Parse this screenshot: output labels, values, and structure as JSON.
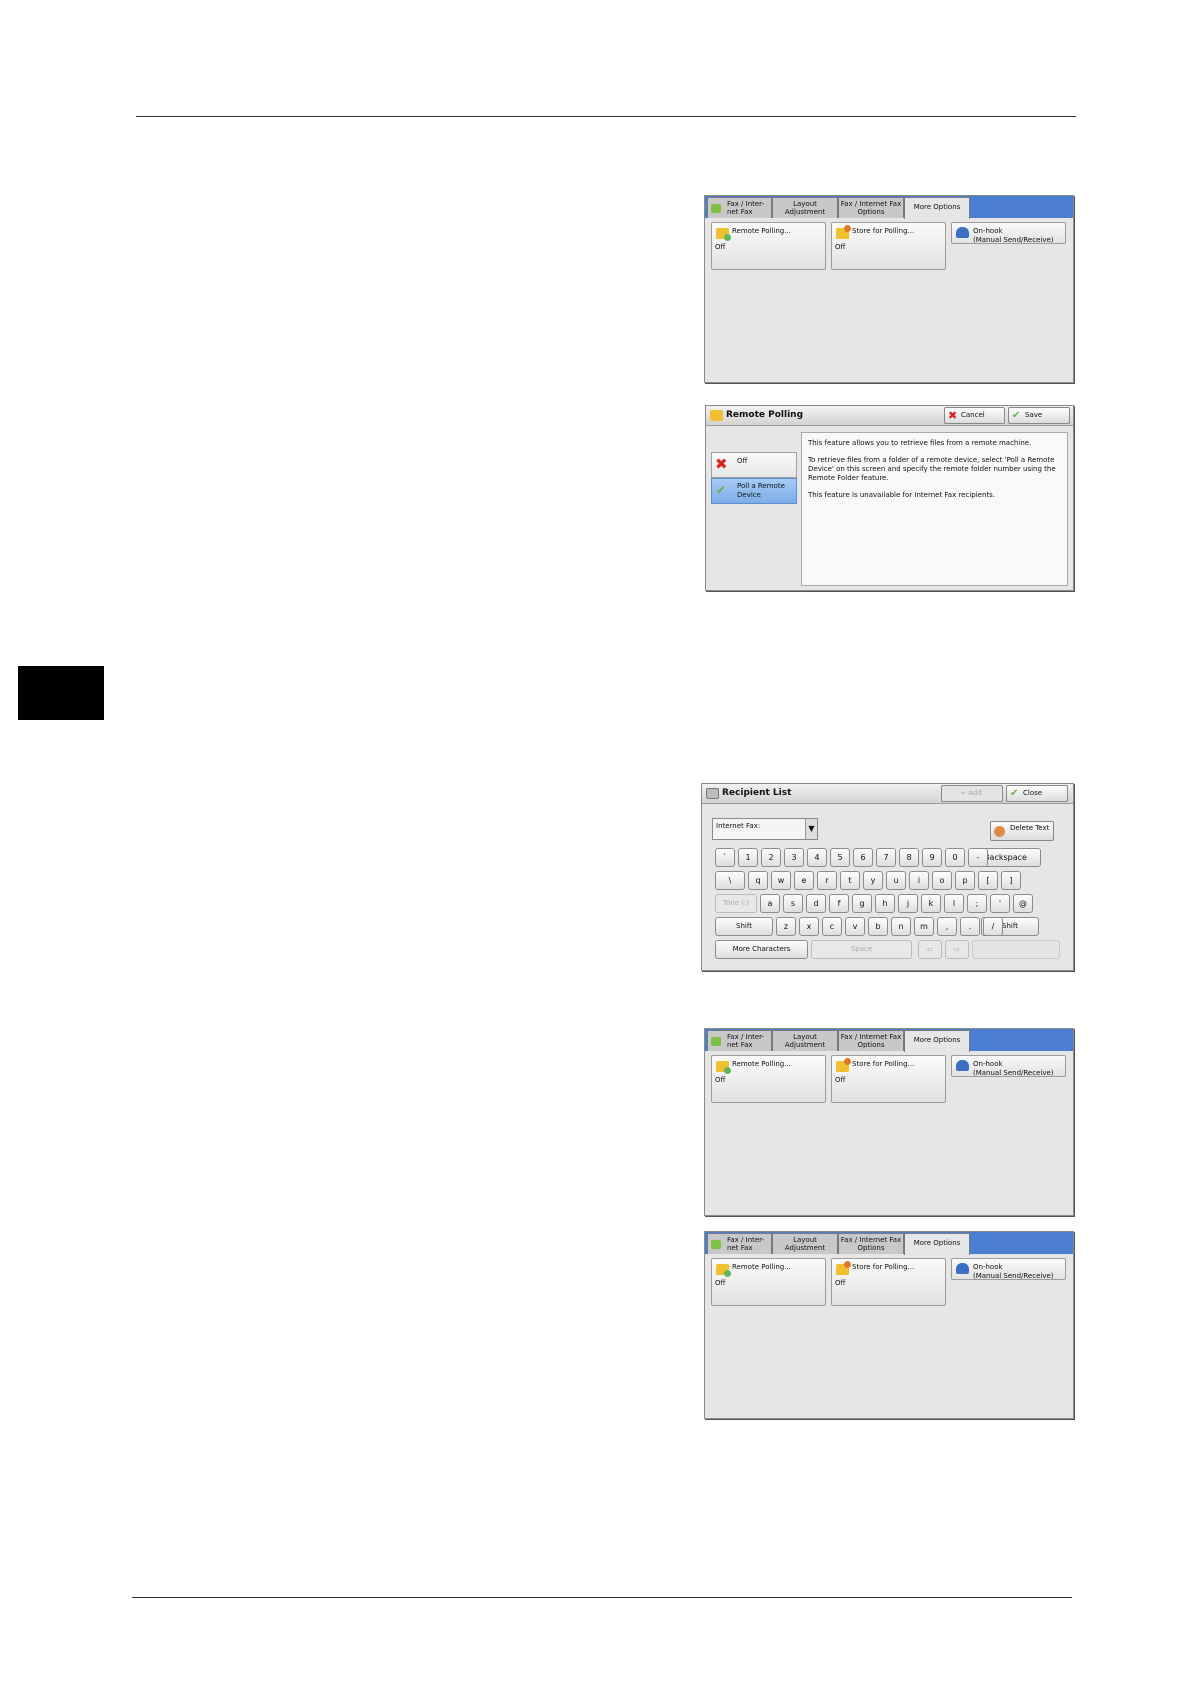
{
  "tabs": [
    "Fax / Inter- net Fax",
    "Layout Adjustment",
    "Fax / Internet Fax Options",
    "More Options"
  ],
  "more_options": {
    "remote_polling_label": "Remote Polling...",
    "remote_polling_value": "Off",
    "store_polling_label": "Store for Polling...",
    "store_polling_value": "Off",
    "onhook_line1": "On-hook",
    "onhook_line2": "(Manual Send/Receive)"
  },
  "remote_polling_dialog": {
    "title": "Remote Polling",
    "cancel": "Cancel",
    "save": "Save",
    "options": [
      "Off",
      "Poll a Remote Device"
    ],
    "info": [
      "This feature allows you to retrieve files from a remote machine.",
      "To retrieve files from a folder of a remote device, select 'Poll a Remote Device' on this screen and specify the remote folder number using the Remote Folder feature.",
      "This feature is unavailable for Internet Fax recipients."
    ]
  },
  "recipient_list": {
    "title": "Recipient List",
    "add": "+ Add",
    "close": "Close",
    "combo_label": "Internet Fax:",
    "delete_text": "Delete Text",
    "row1": [
      "`",
      "1",
      "2",
      "3",
      "4",
      "5",
      "6",
      "7",
      "8",
      "9",
      "0",
      "-"
    ],
    "backspace": "Backspace",
    "row2": [
      "\\",
      "q",
      "w",
      "e",
      "r",
      "t",
      "y",
      "u",
      "i",
      "o",
      "p",
      "[",
      "]"
    ],
    "tone": "Tone (:)",
    "row3": [
      "a",
      "s",
      "d",
      "f",
      "g",
      "h",
      "j",
      "k",
      "l",
      ";",
      "'",
      "@"
    ],
    "shift": "Shift",
    "row4": [
      "z",
      "x",
      "c",
      "v",
      "b",
      "n",
      "m",
      ",",
      ".",
      "/"
    ],
    "more_characters": "More Characters",
    "space": "Space",
    "left_arrow": "⇦",
    "right_arrow": "⇨"
  }
}
